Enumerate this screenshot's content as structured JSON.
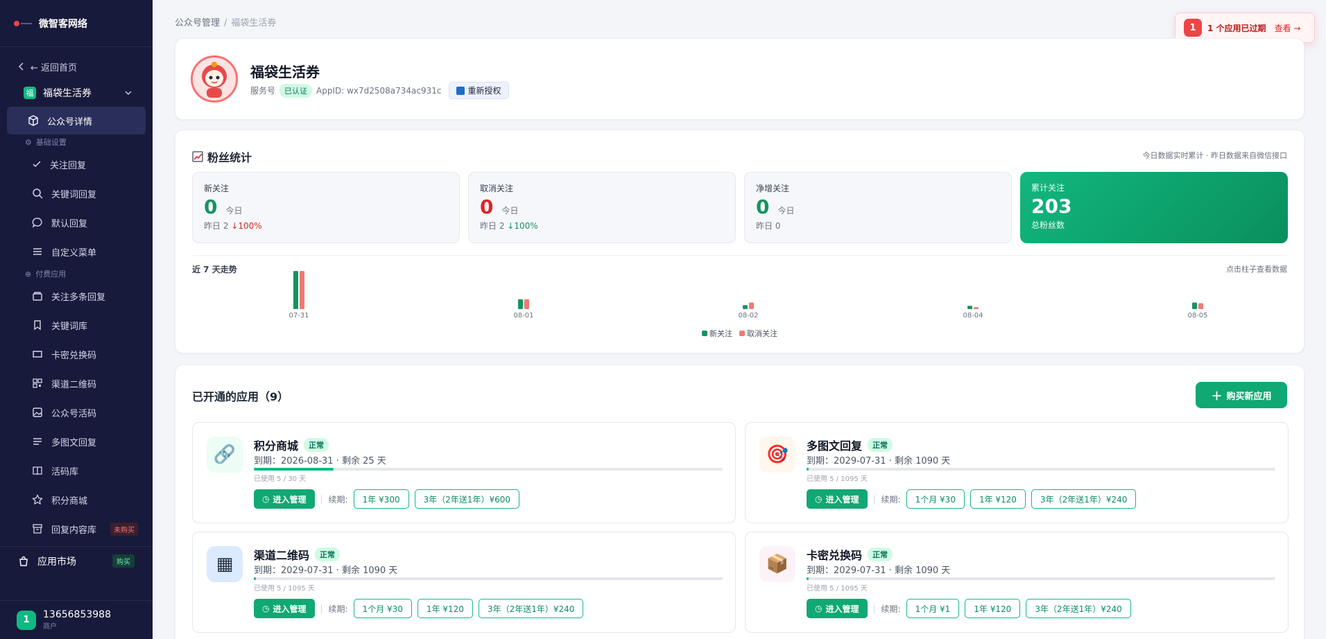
{
  "brand": {
    "name": "微智客网络"
  },
  "sidebar": {
    "back": "← 返回首页",
    "current_app": "福袋生活券",
    "items": [
      {
        "label": "公众号详情"
      },
      {
        "label": "关注回复"
      },
      {
        "label": "关键词回复"
      },
      {
        "label": "默认回复"
      },
      {
        "label": "自定义菜单"
      },
      {
        "label": "关注多条回复"
      },
      {
        "label": "关键词库"
      },
      {
        "label": "卡密兑换码"
      },
      {
        "label": "渠道二维码"
      },
      {
        "label": "公众号活码"
      },
      {
        "label": "多图文回复"
      },
      {
        "label": "活码库"
      },
      {
        "label": "积分商城"
      },
      {
        "label": "回复内容库",
        "badge": "未购买"
      }
    ],
    "groups": {
      "basic": "基础设置",
      "paid": "付费应用"
    },
    "market": {
      "label": "应用市场",
      "badge": "购买"
    },
    "user": {
      "avatar": "1",
      "name": "13656853988",
      "role": "商户"
    }
  },
  "breadcrumb": {
    "parent": "公众号管理",
    "separator": "/",
    "current": "福袋生活券"
  },
  "toast": {
    "count": "1",
    "text": "个应用已过期",
    "link": "查看 →"
  },
  "account": {
    "name": "福袋生活券",
    "type": "服务号",
    "verified": "已认证",
    "appid": "AppID: wx7d2508a734ac931c",
    "reauth": "重新授权"
  },
  "fans": {
    "title": "粉丝统计",
    "note": "今日数据实时累计 · 昨日数据来自微信接口",
    "new": {
      "label": "新关注",
      "value": "0",
      "today": "今日",
      "yesterday": "昨日 2",
      "change": "↓100%"
    },
    "cancel": {
      "label": "取消关注",
      "value": "0",
      "today": "今日",
      "yesterday": "昨日 2",
      "change": "↓100%"
    },
    "net": {
      "label": "净增关注",
      "value": "0",
      "today": "今日",
      "yesterday": "昨日 0"
    },
    "total": {
      "label": "累计关注",
      "value": "203",
      "sub": "总粉丝数"
    },
    "trend_label": "近 7 天走势",
    "trend_note": "点击柱子查看数据",
    "legend_new": "新关注",
    "legend_cancel": "取消关注"
  },
  "chart_data": {
    "type": "bar",
    "categories": [
      "07-31",
      "08-01",
      "08-02",
      "08-04",
      "08-05"
    ],
    "series": [
      {
        "name": "新关注",
        "color": "#15935f",
        "values": [
          58,
          15,
          6,
          5,
          10
        ]
      },
      {
        "name": "取消关注",
        "color": "#ef7a72",
        "values": [
          58,
          15,
          10,
          3,
          9
        ]
      }
    ]
  },
  "apps": {
    "title": "已开通的应用（9）",
    "buy": "购买新应用",
    "enter": "进入管理",
    "renew": "续期:",
    "list": [
      {
        "name": "积分商城",
        "status": "正常",
        "expire": "到期：2026-08-31 · 剩余 25 天",
        "used": "已使用 5 / 30 天",
        "progress": 0.17,
        "icon": "🔗",
        "prices": [
          "1年 ¥300",
          "3年（2年送1年）¥600"
        ]
      },
      {
        "name": "多图文回复",
        "status": "正常",
        "expire": "到期：2029-07-31 · 剩余 1090 天",
        "used": "已使用 5 / 1095 天",
        "progress": 0.005,
        "icon": "🎯",
        "prices": [
          "1个月 ¥30",
          "1年 ¥120",
          "3年（2年送1年）¥240"
        ]
      },
      {
        "name": "渠道二维码",
        "status": "正常",
        "expire": "到期：2029-07-31 · 剩余 1090 天",
        "used": "已使用 5 / 1095 天",
        "progress": 0.005,
        "icon": "▦",
        "prices": [
          "1个月 ¥30",
          "1年 ¥120",
          "3年（2年送1年）¥240"
        ]
      },
      {
        "name": "卡密兑换码",
        "status": "正常",
        "expire": "到期：2029-07-31 · 剩余 1090 天",
        "used": "已使用 5 / 1095 天",
        "progress": 0.005,
        "icon": "📦",
        "prices": [
          "1个月 ¥1",
          "1年 ¥120",
          "3年（2年送1年）¥240"
        ]
      }
    ]
  }
}
